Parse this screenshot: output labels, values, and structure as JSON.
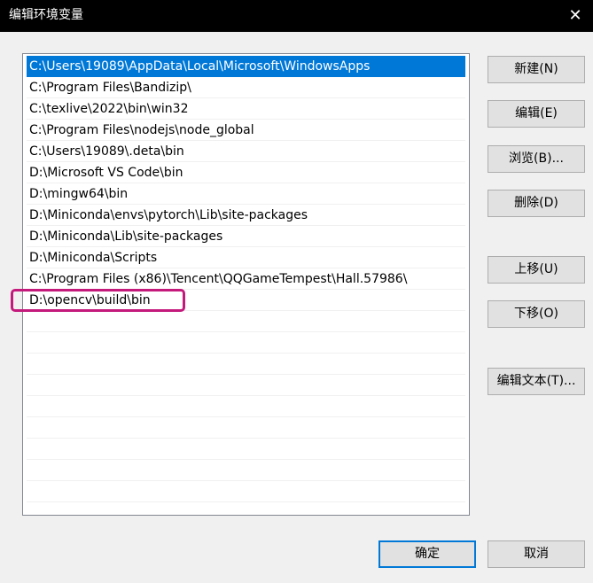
{
  "window": {
    "title": "编辑环境变量",
    "close_glyph": "✕"
  },
  "paths": [
    "C:\\Users\\19089\\AppData\\Local\\Microsoft\\WindowsApps",
    "C:\\Program Files\\Bandizip\\",
    "C:\\texlive\\2022\\bin\\win32",
    "C:\\Program Files\\nodejs\\node_global",
    "C:\\Users\\19089\\.deta\\bin",
    "D:\\Microsoft VS Code\\bin",
    "D:\\mingw64\\bin",
    "D:\\Miniconda\\envs\\pytorch\\Lib\\site-packages",
    "D:\\Miniconda\\Lib\\site-packages",
    "D:\\Miniconda\\Scripts",
    "C:\\Program Files (x86)\\Tencent\\QQGameTempest\\Hall.57986\\",
    "D:\\opencv\\build\\bin"
  ],
  "selected_index": 0,
  "buttons": {
    "new": "新建(N)",
    "edit": "编辑(E)",
    "browse": "浏览(B)...",
    "delete": "删除(D)",
    "move_up": "上移(U)",
    "move_down": "下移(O)",
    "edit_text": "编辑文本(T)...",
    "ok": "确定",
    "cancel": "取消"
  },
  "colors": {
    "selection": "#0078d7",
    "annotation": "#c41a7c"
  }
}
